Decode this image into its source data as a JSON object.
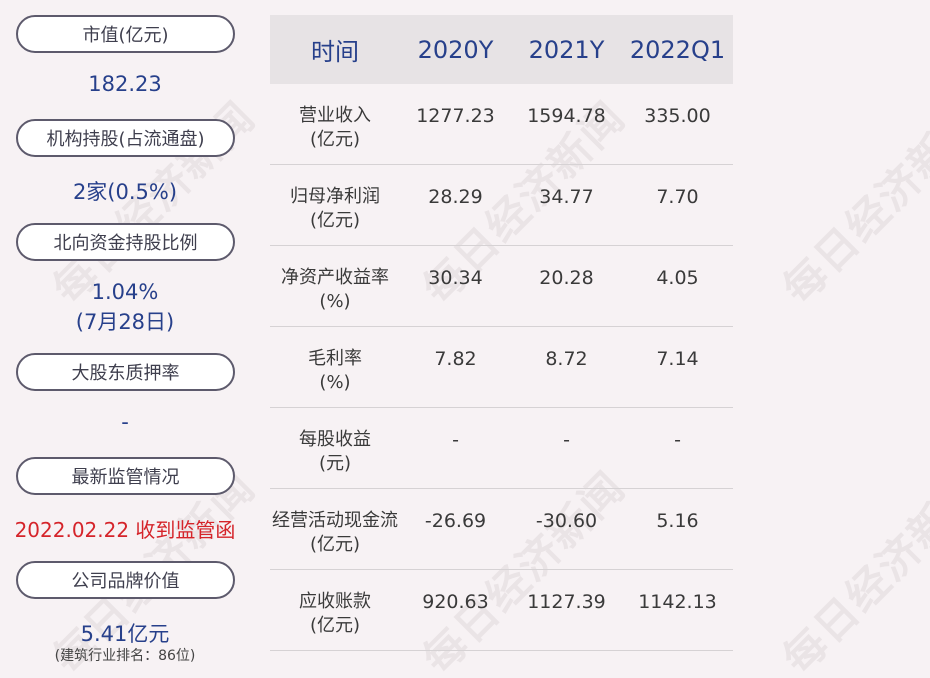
{
  "watermark": "每日经济新闻",
  "left_panel": {
    "market_cap": {
      "label": "市值(亿元)",
      "value": "182.23"
    },
    "institutions": {
      "label": "机构持股(占流通盘)",
      "value": "2家(0.5%)"
    },
    "northbound": {
      "label": "北向资金持股比例",
      "value": "1.04%",
      "date": "(7月28日)"
    },
    "pledge": {
      "label": "大股东质押率",
      "value": "-"
    },
    "regulation": {
      "label": "最新监管情况",
      "value": "2022.02.22 收到监管函"
    },
    "brand": {
      "label": "公司品牌价值",
      "value": "5.41亿元",
      "note": "(建筑行业排名：86位)"
    }
  },
  "table": {
    "headers": [
      "时间",
      "2020Y",
      "2021Y",
      "2022Q1"
    ],
    "rows": [
      {
        "label": [
          "营业收入",
          "(亿元)"
        ],
        "values": [
          "1277.23",
          "1594.78",
          "335.00"
        ]
      },
      {
        "label": [
          "归母净利润",
          "(亿元)"
        ],
        "values": [
          "28.29",
          "34.77",
          "7.70"
        ]
      },
      {
        "label": [
          "净资产收益率",
          "(%)"
        ],
        "values": [
          "30.34",
          "20.28",
          "4.05"
        ]
      },
      {
        "label": [
          "毛利率",
          "(%)"
        ],
        "values": [
          "7.82",
          "8.72",
          "7.14"
        ]
      },
      {
        "label": [
          "每股收益",
          "(元)"
        ],
        "values": [
          "-",
          "-",
          "-"
        ]
      },
      {
        "label": [
          "经营活动现金流",
          "(亿元)"
        ],
        "values": [
          "-26.69",
          "-30.60",
          "5.16"
        ]
      },
      {
        "label": [
          "应收账款",
          "(亿元)"
        ],
        "values": [
          "920.63",
          "1127.39",
          "1142.13"
        ]
      }
    ]
  }
}
